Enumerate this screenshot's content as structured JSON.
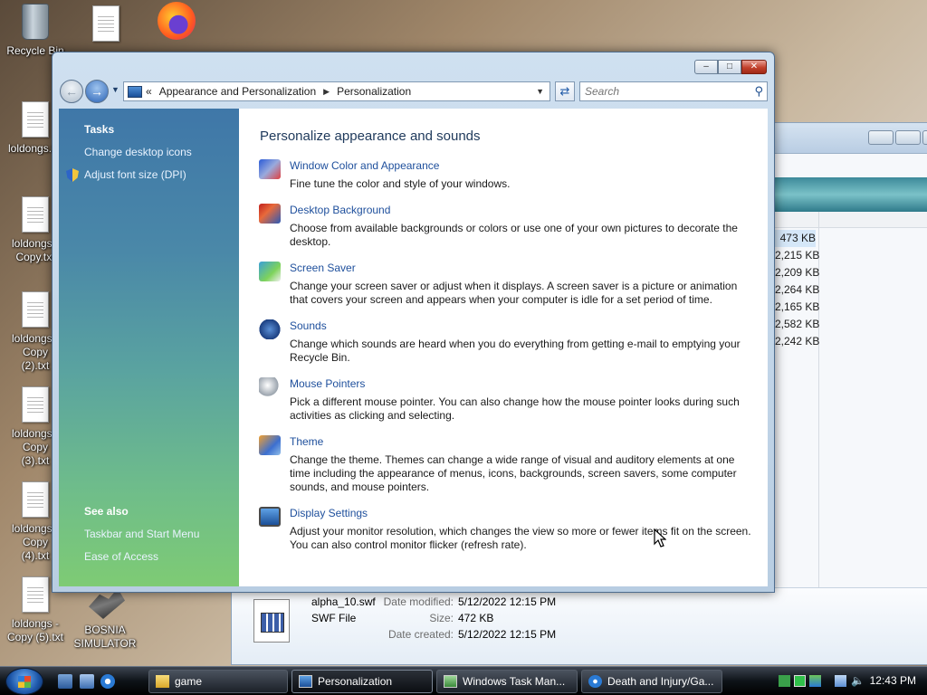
{
  "desktop": {
    "icons": [
      {
        "label": "Recycle Bin"
      },
      {
        "label": ""
      },
      {
        "label": ""
      },
      {
        "label": "loldongs.txt"
      },
      {
        "label": "loldongs - Copy.txt"
      },
      {
        "label": "loldongs - Copy (2).txt"
      },
      {
        "label": "loldongs - Copy (3).txt"
      },
      {
        "label": "loldongs - Copy (4).txt"
      },
      {
        "label": "loldongs - Copy (5).txt"
      },
      {
        "label": "BOSNIA SIMULATOR"
      }
    ]
  },
  "background_window": {
    "sizes": [
      "473 KB",
      "2,215 KB",
      "2,209 KB",
      "2,264 KB",
      "2,165 KB",
      "2,582 KB",
      "2,242 KB"
    ],
    "details": {
      "file_name": "alpha_10.swf",
      "file_type": "SWF File",
      "date_modified_label": "Date modified:",
      "date_modified": "5/12/2022 12:15 PM",
      "size_label": "Size:",
      "size": "472 KB",
      "date_created_label": "Date created:",
      "date_created": "5/12/2022 12:15 PM"
    }
  },
  "window": {
    "controls": {
      "minimize": "–",
      "maximize": "□",
      "close": "✕"
    },
    "address": {
      "chevrons": "«",
      "segments": [
        "Appearance and Personalization",
        "Personalization"
      ]
    },
    "search": {
      "placeholder": "Search"
    },
    "sidebar": {
      "tasks_heading": "Tasks",
      "tasks": [
        "Change desktop icons",
        "Adjust font size (DPI)"
      ],
      "see_also_heading": "See also",
      "see_also": [
        "Taskbar and Start Menu",
        "Ease of Access"
      ]
    },
    "content": {
      "heading": "Personalize appearance and sounds",
      "items": [
        {
          "title": "Window Color and Appearance",
          "desc": "Fine tune the color and style of your windows.",
          "icon": "window-color-icon"
        },
        {
          "title": "Desktop Background",
          "desc": "Choose from available backgrounds or colors or use one of your own pictures to decorate the desktop.",
          "icon": "desktop-background-icon"
        },
        {
          "title": "Screen Saver",
          "desc": "Change your screen saver or adjust when it displays. A screen saver is a picture or animation that covers your screen and appears when your computer is idle for a set period of time.",
          "icon": "screen-saver-icon"
        },
        {
          "title": "Sounds",
          "desc": "Change which sounds are heard when you do everything from getting e-mail to emptying your Recycle Bin.",
          "icon": "sounds-icon"
        },
        {
          "title": "Mouse Pointers",
          "desc": "Pick a different mouse pointer. You can also change how the mouse pointer looks during such activities as clicking and selecting.",
          "icon": "mouse-pointers-icon"
        },
        {
          "title": "Theme",
          "desc": "Change the theme. Themes can change a wide range of visual and auditory elements at one time including the appearance of menus, icons, backgrounds, screen savers, some computer sounds, and mouse pointers.",
          "icon": "theme-icon"
        },
        {
          "title": "Display Settings",
          "desc": "Adjust your monitor resolution, which changes the view so more or fewer items fit on the screen. You can also control monitor flicker (refresh rate).",
          "icon": "display-settings-icon"
        }
      ]
    }
  },
  "taskbar": {
    "buttons": [
      "game",
      "Personalization",
      "Windows Task Man...",
      "Death and Injury/Ga..."
    ],
    "clock": "12:43 PM"
  }
}
